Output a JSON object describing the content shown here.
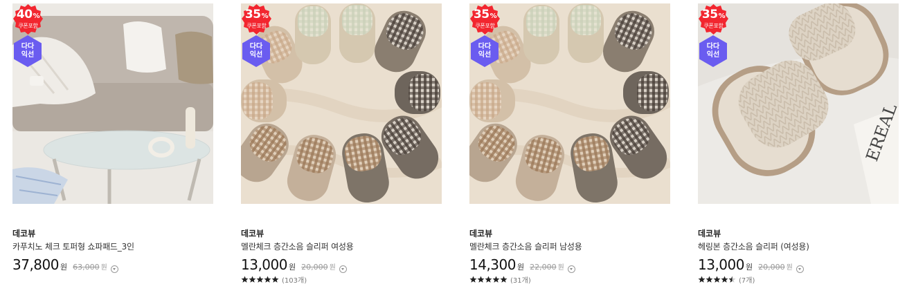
{
  "products": [
    {
      "discount": "40",
      "discount_unit": "%",
      "coupon_label": "쿠폰포함",
      "dada_label": "다다\n익선",
      "brand": "데코뷰",
      "name": "카푸치노 체크 토퍼형 쇼파패드_3인",
      "price": "37,800",
      "price_unit": "원",
      "original_price": "63,000",
      "original_unit": "원",
      "rating": null,
      "review_count": ""
    },
    {
      "discount": "35",
      "discount_unit": "%",
      "coupon_label": "쿠폰포함",
      "dada_label": "다다\n익선",
      "brand": "데코뷰",
      "name": "멜란체크 층간소음 슬리퍼 여성용",
      "price": "13,000",
      "price_unit": "원",
      "original_price": "20,000",
      "original_unit": "원",
      "rating": 5,
      "review_count": "(103개)"
    },
    {
      "discount": "35",
      "discount_unit": "%",
      "coupon_label": "쿠폰포함",
      "dada_label": "다다\n익선",
      "brand": "데코뷰",
      "name": "멜란체크 층간소음 슬리퍼 남성용",
      "price": "14,300",
      "price_unit": "원",
      "original_price": "22,000",
      "original_unit": "원",
      "rating": 5,
      "review_count": "(31개)"
    },
    {
      "discount": "35",
      "discount_unit": "%",
      "coupon_label": "쿠폰포함",
      "dada_label": "다다\n익선",
      "brand": "데코뷰",
      "name": "헤링본 층간소음 슬리퍼 (여성용)",
      "price": "13,000",
      "price_unit": "원",
      "original_price": "20,000",
      "original_unit": "원",
      "rating": 4.5,
      "review_count": "(7개)"
    }
  ],
  "colors": {
    "sale_badge": "#f2262f",
    "dada_badge": "#6a5cf0",
    "star": "#222222"
  }
}
